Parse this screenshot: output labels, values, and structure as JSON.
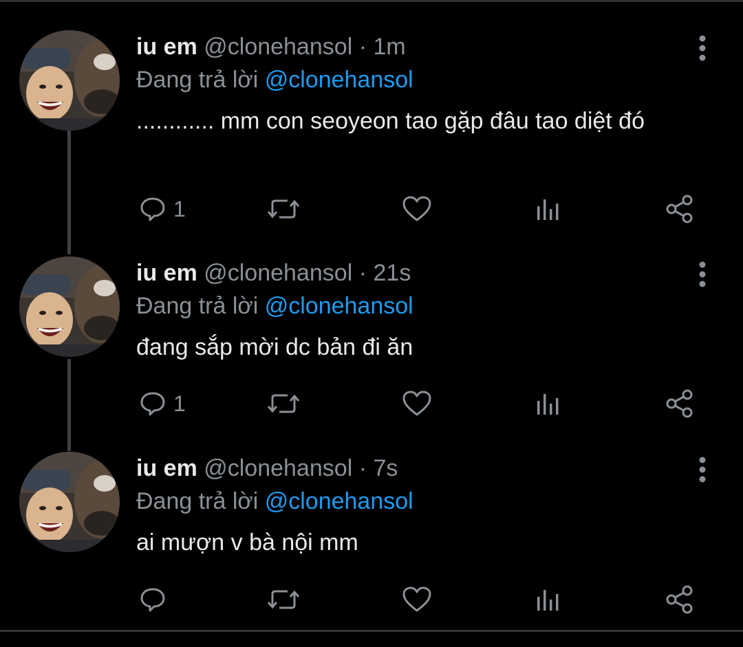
{
  "colors": {
    "background": "#000000",
    "text_primary": "#e7e9ea",
    "text_secondary": "#8b9096",
    "mention": "#1d9bf0",
    "thread_line": "#3e4144"
  },
  "tweets": [
    {
      "name": "iu em",
      "handle": "@clonehansol",
      "separator": "·",
      "time": "1m",
      "reply_prefix": "Đang trả lời",
      "reply_to": "@clonehansol",
      "text": "............ mm con seoyeon tao gặp đâu tao diệt đó",
      "reply_count": "1",
      "icons": [
        "reply-icon",
        "retweet-icon",
        "like-icon",
        "analytics-icon",
        "share-icon",
        "more-icon"
      ]
    },
    {
      "name": "iu em",
      "handle": "@clonehansol",
      "separator": "·",
      "time": "21s",
      "reply_prefix": "Đang trả lời",
      "reply_to": "@clonehansol",
      "text": "đang sắp mời dc bản đi ăn",
      "reply_count": "1",
      "icons": [
        "reply-icon",
        "retweet-icon",
        "like-icon",
        "analytics-icon",
        "share-icon",
        "more-icon"
      ]
    },
    {
      "name": "iu em",
      "handle": "@clonehansol",
      "separator": "·",
      "time": "7s",
      "reply_prefix": "Đang trả lời",
      "reply_to": "@clonehansol",
      "text": "ai mượn v bà nội mm",
      "reply_count": "",
      "icons": [
        "reply-icon",
        "retweet-icon",
        "like-icon",
        "analytics-icon",
        "share-icon",
        "more-icon"
      ]
    }
  ]
}
